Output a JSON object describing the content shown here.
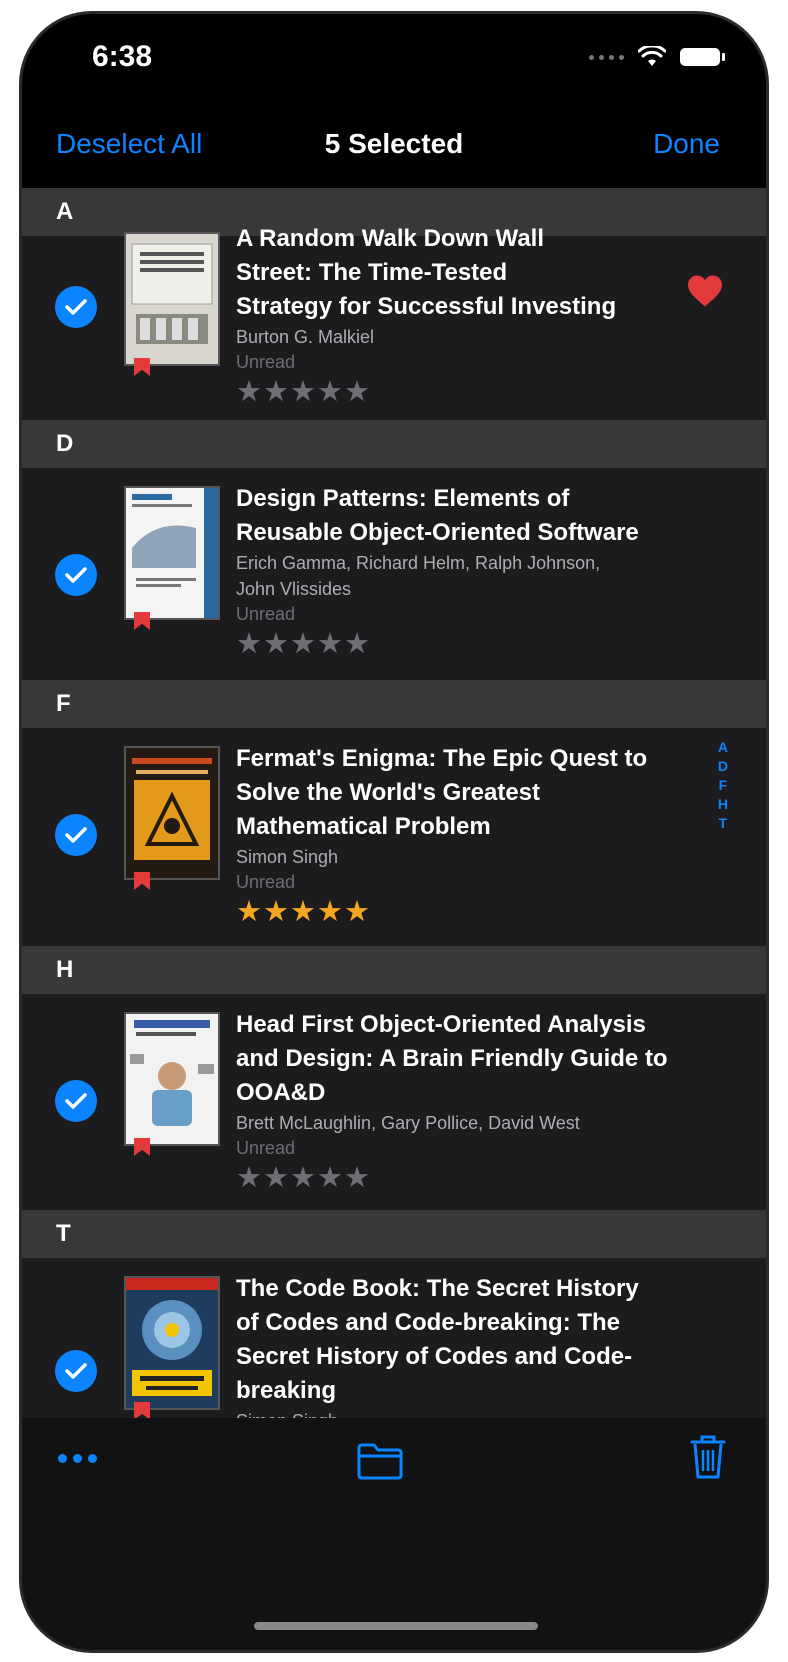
{
  "status": {
    "time": "6:38"
  },
  "nav": {
    "left": "Deselect All",
    "title": "5 Selected",
    "right": "Done"
  },
  "sections": [
    {
      "letter": "A"
    },
    {
      "letter": "D"
    },
    {
      "letter": "F"
    },
    {
      "letter": "H"
    },
    {
      "letter": "T"
    }
  ],
  "books": [
    {
      "title_line0": "A Random Walk Down Wall",
      "title_line1": "Street: The Time-Tested",
      "title_line2": "Strategy for Successful Investing",
      "author": "Burton G. Malkiel",
      "state": "Unread",
      "rating": 0,
      "favorite": true
    },
    {
      "title_line1": "Design Patterns: Elements of",
      "title_line2": "Reusable Object-Oriented Software",
      "author_line1": "Erich Gamma, Richard Helm, Ralph Johnson,",
      "author_line2": "John Vlissides",
      "state": "Unread",
      "rating": 0
    },
    {
      "title_line1": "Fermat's Enigma: The Epic Quest to",
      "title_line2": "Solve the World's Greatest",
      "title_line3": "Mathematical Problem",
      "author": "Simon Singh",
      "state": "Unread",
      "rating": 5
    },
    {
      "title_line1": "Head First Object-Oriented Analysis",
      "title_line2": "and Design: A Brain Friendly Guide to",
      "title_line3": "OOA&D",
      "author": "Brett McLaughlin, Gary Pollice, David West",
      "state": "Unread",
      "rating": 0
    },
    {
      "title_line1": "The Code Book: The Secret History",
      "title_line2": "of Codes and Code-breaking: The",
      "title_line3": "Secret History of Codes and Code-",
      "title_line4": "breaking",
      "author": "Simon Singh"
    }
  ],
  "index": [
    "A",
    "D",
    "F",
    "H",
    "T"
  ],
  "icons": {
    "check": "checkmark-circle-icon",
    "heart": "heart-icon",
    "more": "ellipsis-icon",
    "folder": "folder-icon",
    "trash": "trash-icon"
  },
  "colors": {
    "accent": "#0a84ff",
    "star_gold": "#f5a623",
    "heart": "#e33b3b"
  }
}
